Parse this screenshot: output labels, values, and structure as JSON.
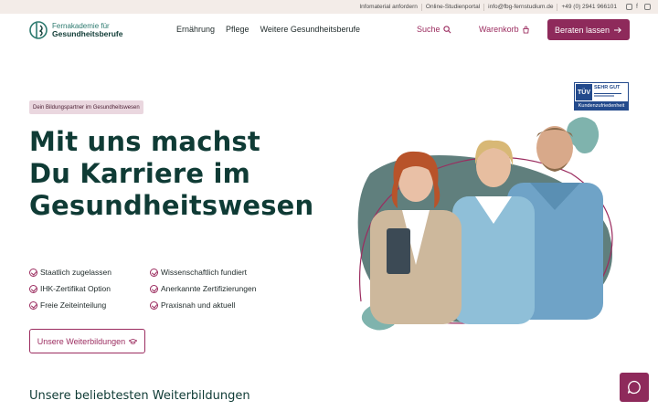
{
  "topbar": {
    "links": [
      "Infomaterial anfordern",
      "Online-Studienportal",
      "info@fbg-fernstudium.de",
      "+49 (0) 2941 966101"
    ],
    "social": [
      "instagram-icon",
      "facebook-icon",
      "linkedin-icon"
    ]
  },
  "logo": {
    "line1": "Fernakademie für",
    "line2": "Gesundheitsberufe"
  },
  "nav": {
    "items": [
      "Ernährung",
      "Pflege",
      "Weitere Gesundheitsberufe"
    ],
    "search_label": "Suche",
    "cart_label": "Warenkorb",
    "cta_label": "Beraten lassen"
  },
  "hero": {
    "badge": "Dein Bildungspartner im Gesundheitswesen",
    "headline": [
      "Mit uns machst",
      "Du Karriere im",
      "Gesundheitswesen"
    ],
    "features": [
      "Staatlich zugelassen",
      "Wissenschaftlich fundiert",
      "IHK-Zertifikat Option",
      "Anerkannte Zertifizierungen",
      "Freie Zeiteinteilung",
      "Praxisnah und aktuell"
    ],
    "button_label": "Unsere Weiterbildungen"
  },
  "tuv": {
    "logo": "TÜV",
    "rating": "SEHR GUT",
    "label": "Kundenzufriedenheit"
  },
  "section": {
    "title": "Unsere beliebtesten Weiterbildungen"
  },
  "colors": {
    "primary": "#0f3b35",
    "accent": "#8e2a5b",
    "teal": "#7fb3ad",
    "topbar": "#f3ece8"
  }
}
